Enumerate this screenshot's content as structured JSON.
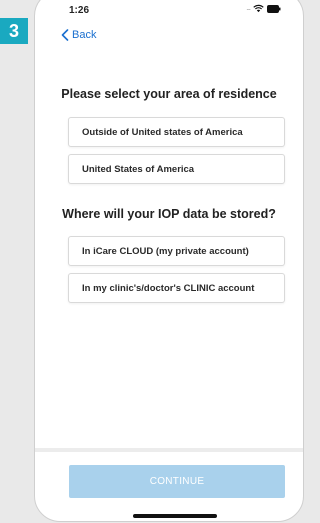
{
  "step": {
    "number": "3"
  },
  "status_bar": {
    "time": "1:26",
    "signal": "....",
    "icons": [
      "wifi-icon",
      "battery-icon"
    ]
  },
  "nav": {
    "back_label": "Back"
  },
  "residence": {
    "heading": "Please select your area of residence",
    "options": [
      "Outside of United states of America",
      "United States of America"
    ]
  },
  "storage": {
    "heading": "Where will your IOP data be stored?",
    "options": [
      "In iCare CLOUD (my private account)",
      "In my clinic's/doctor's CLINIC account"
    ]
  },
  "continue_label": "CONTINUE",
  "colors": {
    "badge": "#1aa9c0",
    "link": "#1a6fcf",
    "continue_disabled": "#a9d1ec",
    "background": "#e9e9e9"
  }
}
